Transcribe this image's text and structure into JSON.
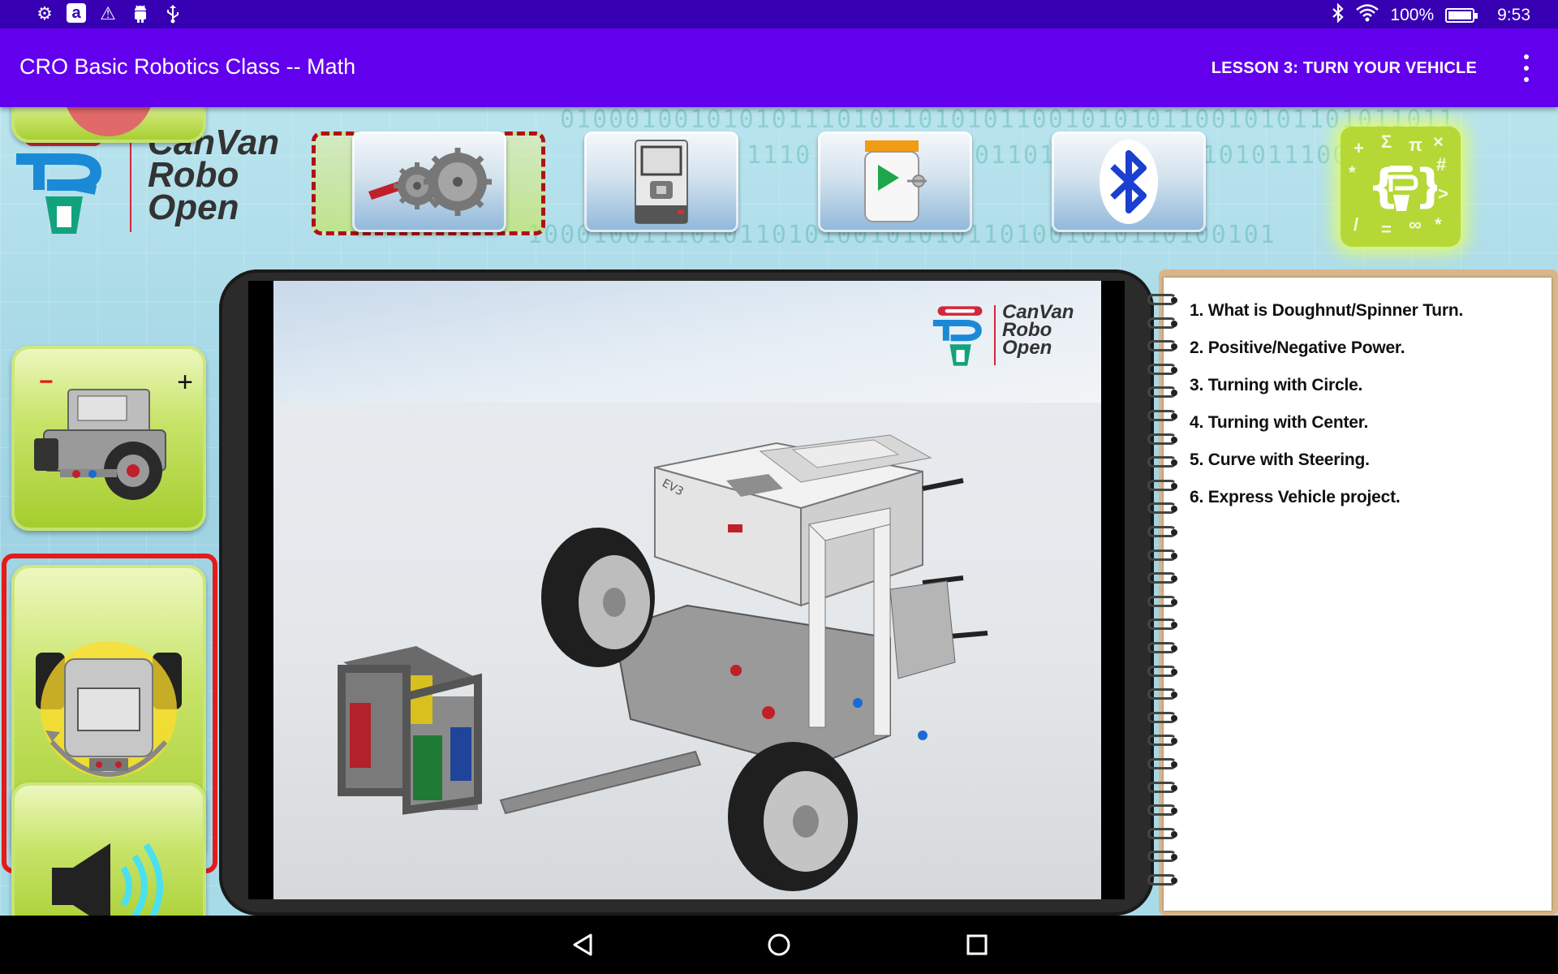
{
  "status_bar": {
    "left_icons": [
      "gear-icon",
      "amazon-icon",
      "warning-icon",
      "android-debug-icon",
      "usb-icon"
    ],
    "amazon_glyph": "a",
    "battery_percent": "100%",
    "battery_level": 1.0,
    "time": "9:53"
  },
  "app_bar": {
    "title": "CRO Basic Robotics Class -- Math",
    "lesson": "LESSON 3: TURN YOUR VEHICLE"
  },
  "logo": {
    "line1": "CanVan",
    "line2": "Robo",
    "line3": "Open"
  },
  "toolbar": {
    "items": [
      "gears-icon",
      "ev3-brick-icon",
      "program-block-icon",
      "bluetooth-icon",
      "code-icon"
    ]
  },
  "side_buttons": [
    "partial-button",
    "motor-power-icon",
    "spinner-turn-icon",
    "speaker-icon"
  ],
  "side_labels": {
    "minus": "−",
    "plus": "+"
  },
  "video": {
    "logo_line1": "CanVan",
    "logo_line2": "Robo",
    "logo_line3": "Open",
    "brick_label": "EV3"
  },
  "topics": [
    "1. What is Doughnut/Spinner Turn.",
    "2. Positive/Negative Power.",
    "3. Turning with Circle.",
    "4. Turning with Center.",
    "5. Curve with Steering.",
    "6. Express Vehicle project."
  ],
  "colors": {
    "status_bar": "#3700b3",
    "app_bar": "#6200ee",
    "selected_border": "#e21b1b",
    "brand_red": "#d1283a",
    "brand_teal": "#13a37c",
    "brand_blue": "#1b8ad6"
  },
  "background_text": {
    "row1": "0100010010101011101011010101100101010110010101101011011",
    "row2": "1110 010110 010110101100101010101110010101",
    "row3": "1000100111010110101001010101101001010110100101"
  },
  "navbar": [
    "back-icon",
    "home-icon",
    "recents-icon"
  ]
}
